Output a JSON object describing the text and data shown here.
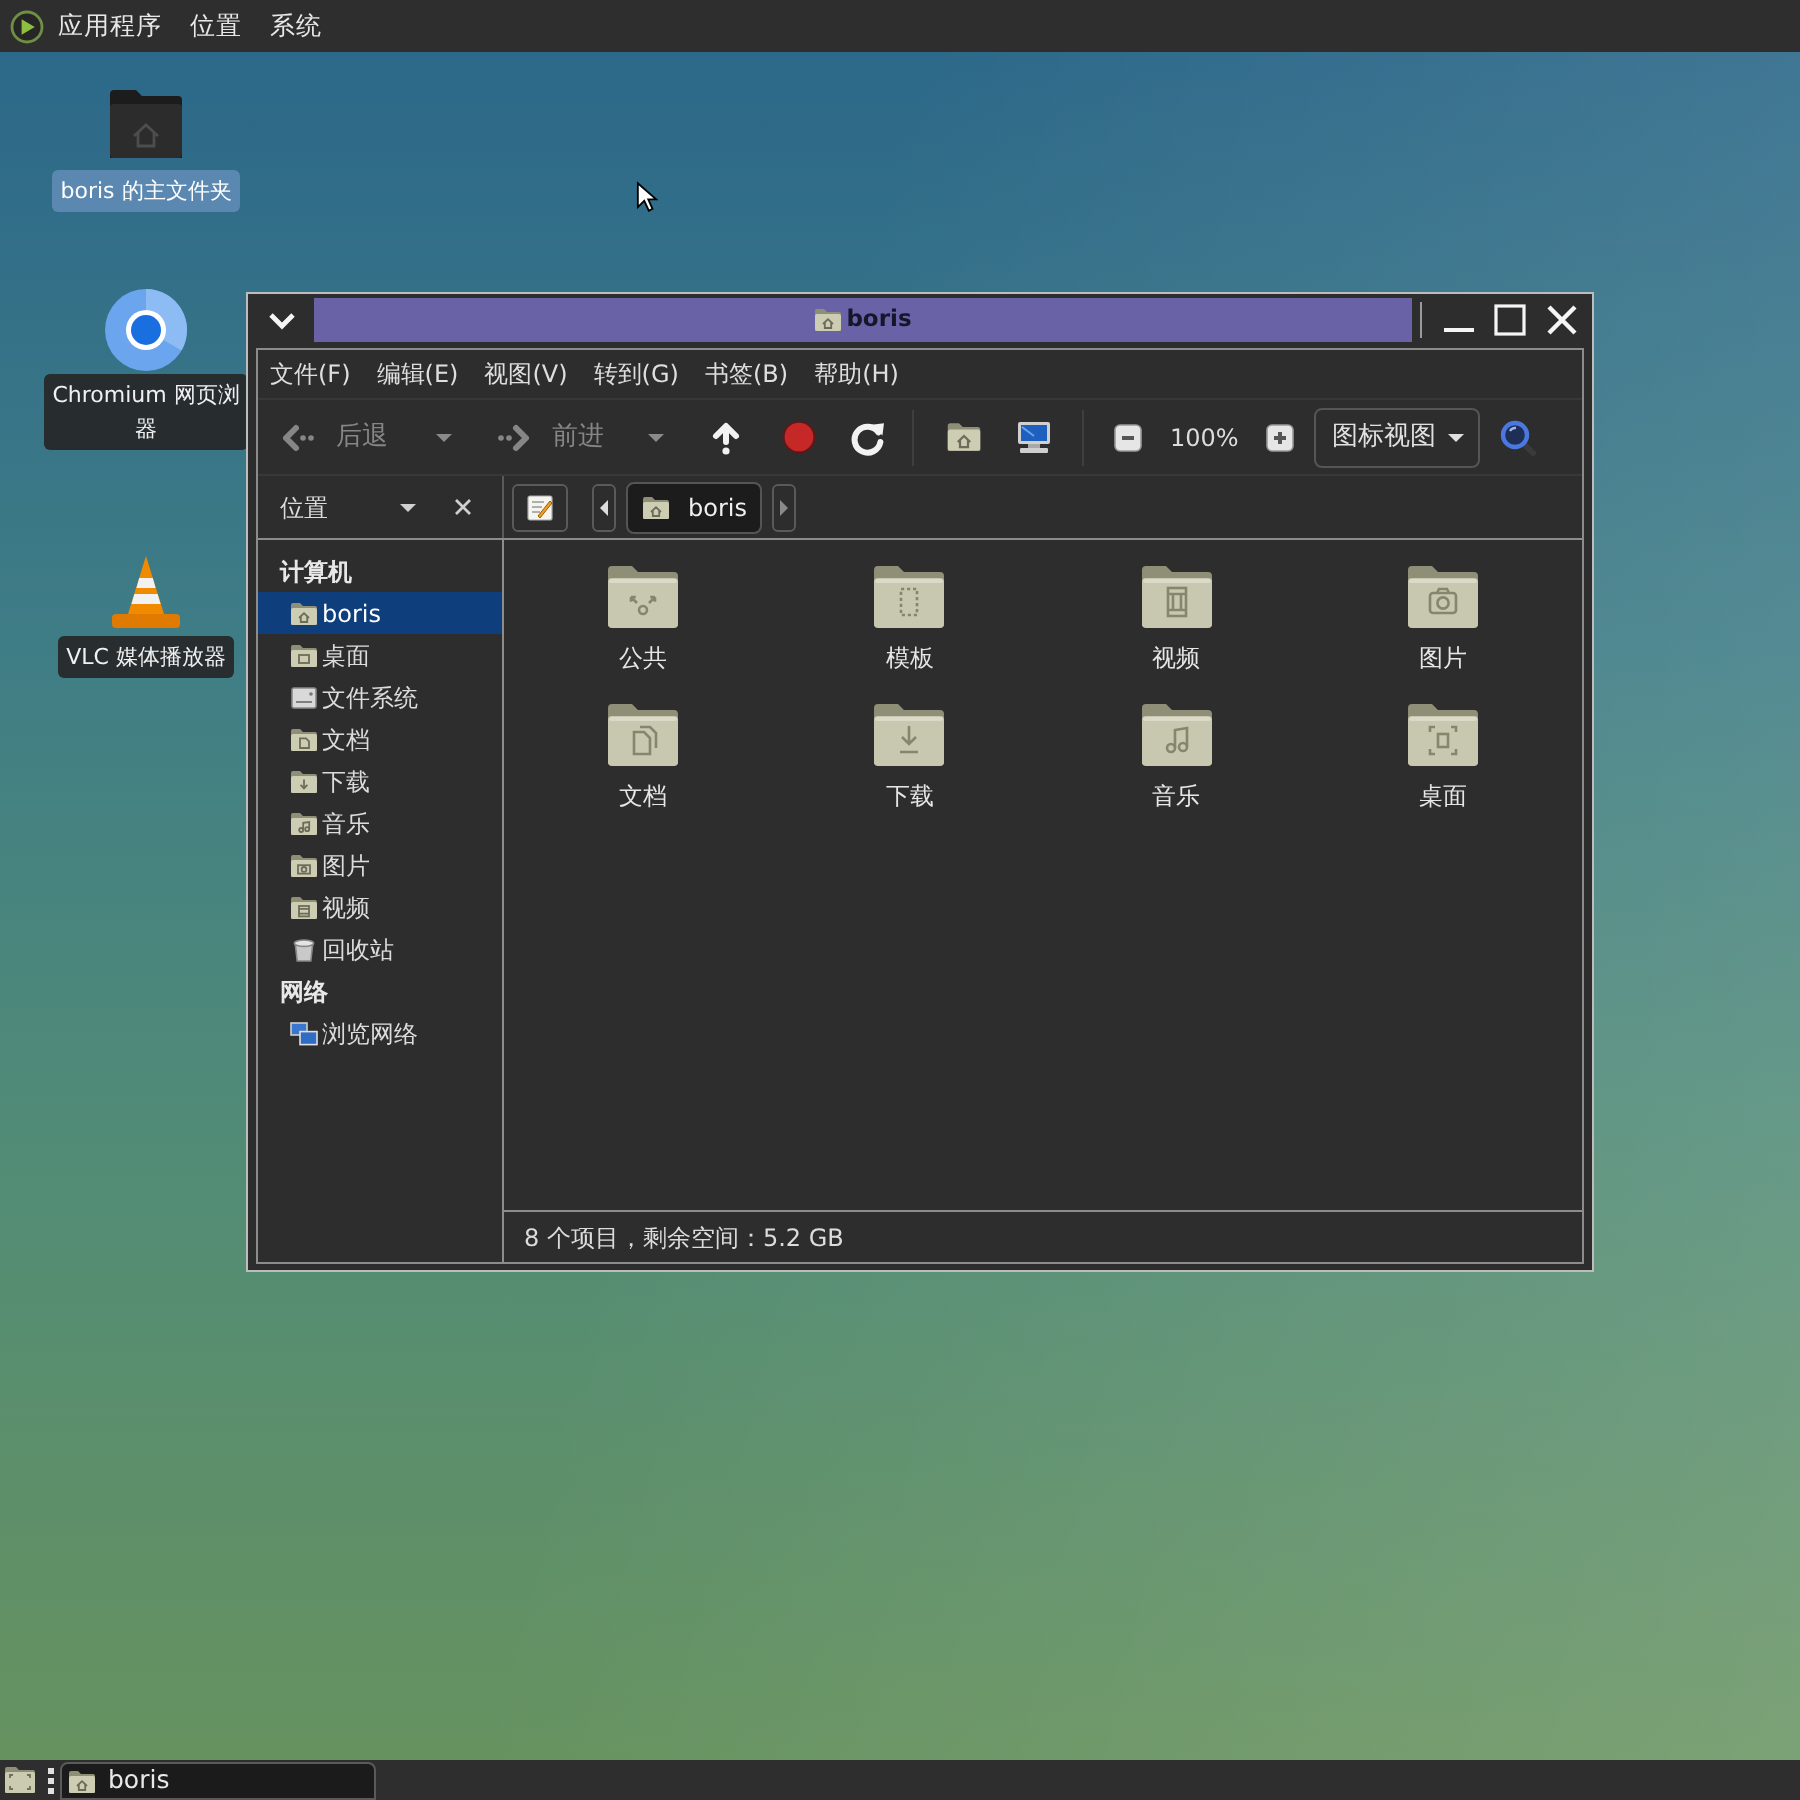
{
  "top_panel": {
    "menus": [
      "应用程序",
      "位置",
      "系统"
    ]
  },
  "desktop_icons": [
    {
      "kind": "home_folder",
      "label_lines": [
        "boris 的主文件夹"
      ],
      "selected": true
    },
    {
      "kind": "browser",
      "label_lines": [
        "Chromium 网页浏",
        "器"
      ],
      "selected": false
    },
    {
      "kind": "media_player",
      "label_lines": [
        "VLC 媒体播放器"
      ],
      "selected": false
    }
  ],
  "window": {
    "title": "boris",
    "menu": [
      "文件(F)",
      "编辑(E)",
      "视图(V)",
      "转到(G)",
      "书签(B)",
      "帮助(H)"
    ],
    "toolbar": {
      "back": {
        "label": "后退",
        "disabled": true
      },
      "forward": {
        "label": "前进",
        "disabled": true
      },
      "zoom_level": "100%",
      "view_mode": "图标视图"
    },
    "sidebar_header": "位置",
    "path_bar": [
      {
        "label": "boris",
        "selected": true
      }
    ],
    "sidebar": [
      {
        "heading": "计算机",
        "items": [
          {
            "label": "boris",
            "kind": "home",
            "selected": true
          },
          {
            "label": "桌面",
            "kind": "desktop",
            "selected": false
          },
          {
            "label": "文件系统",
            "kind": "filesystem",
            "selected": false
          },
          {
            "label": "文档",
            "kind": "documents",
            "selected": false
          },
          {
            "label": "下载",
            "kind": "downloads",
            "selected": false
          },
          {
            "label": "音乐",
            "kind": "music",
            "selected": false
          },
          {
            "label": "图片",
            "kind": "pictures",
            "selected": false
          },
          {
            "label": "视频",
            "kind": "videos",
            "selected": false
          },
          {
            "label": "回收站",
            "kind": "trash",
            "selected": false
          }
        ]
      },
      {
        "heading": "网络",
        "items": [
          {
            "label": "浏览网络",
            "kind": "network",
            "selected": false
          }
        ]
      }
    ],
    "files": [
      {
        "name": "公共",
        "kind": "public",
        "selected": false
      },
      {
        "name": "模板",
        "kind": "templates",
        "selected": false
      },
      {
        "name": "视频",
        "kind": "videos",
        "selected": false
      },
      {
        "name": "图片",
        "kind": "pictures",
        "selected": false
      },
      {
        "name": "文档",
        "kind": "documents",
        "selected": false
      },
      {
        "name": "下载",
        "kind": "downloads",
        "selected": false
      },
      {
        "name": "音乐",
        "kind": "music",
        "selected": false
      },
      {
        "name": "桌面",
        "kind": "desktop",
        "selected": false
      }
    ],
    "status": "8 个项目，剩余空间：5.2 GB"
  },
  "taskbar": {
    "tasks": [
      {
        "label": "boris",
        "selected": true
      }
    ]
  }
}
